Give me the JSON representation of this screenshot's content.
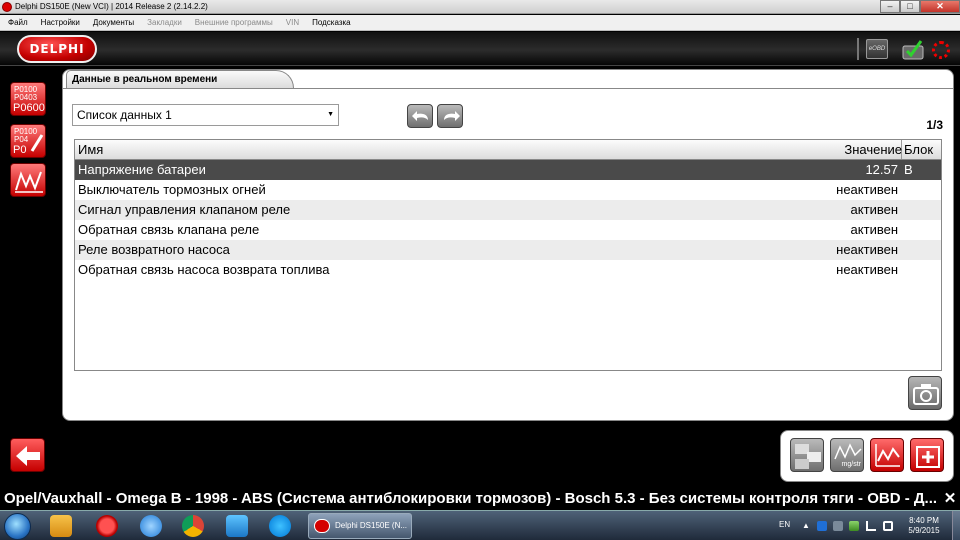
{
  "window": {
    "title": "Delphi DS150E (New VCI) | 2014 Release 2 (2.14.2.2)",
    "minimize": "–",
    "maximize": "□",
    "close": "✕"
  },
  "menu": [
    {
      "label": "Файл",
      "enabled": true
    },
    {
      "label": "Настройки",
      "enabled": true
    },
    {
      "label": "Документы",
      "enabled": true
    },
    {
      "label": "Закладки",
      "enabled": false
    },
    {
      "label": "Внешние программы",
      "enabled": false
    },
    {
      "label": "VIN",
      "enabled": false
    },
    {
      "label": "Подсказка",
      "enabled": true
    }
  ],
  "header": {
    "logo_text": "DELPHI",
    "eobd_label": "eOBD"
  },
  "sidebar": {
    "btn1": {
      "l1": "P0100",
      "l2": "P0403",
      "l3": "P0600"
    },
    "btn2": {
      "l1": "P0100",
      "l2": "P04",
      "l3": "P0"
    }
  },
  "panel": {
    "tab_title": "Данные в реальном времени",
    "dataset_selected": "Список данных 1",
    "page_indicator": "1/3"
  },
  "table": {
    "columns": {
      "name": "Имя",
      "value": "Значение",
      "unit": "Блок"
    },
    "rows": [
      {
        "name": "Напряжение батареи",
        "value": "12.57",
        "unit": "В"
      },
      {
        "name": "Выключатель тормозных огней",
        "value": "неактивен",
        "unit": ""
      },
      {
        "name": "Сигнал управления клапаном реле",
        "value": "активен",
        "unit": ""
      },
      {
        "name": "Обратная связь клапана реле",
        "value": "активен",
        "unit": ""
      },
      {
        "name": "Реле возвратного насоса",
        "value": "неактивен",
        "unit": ""
      },
      {
        "name": "Обратная связь насоса возврата топлива",
        "value": "неактивен",
        "unit": ""
      }
    ]
  },
  "toolbar": {
    "graph_label": "mg/str"
  },
  "status_bar": {
    "text": "Opel/Vauxhall - Omega B - 1998 - ABS (Система антиблокировки тормозов) - Bosch 5.3 - Без системы контроля тяги - OBD - Д...",
    "close": "✕"
  },
  "taskbar": {
    "app_label": "Delphi DS150E (N...",
    "language": "EN",
    "time": "8:40 PM",
    "date": "5/9/2015"
  },
  "colors": {
    "accent_red": "#c50000",
    "selected_row": "#4a4a4a",
    "alt_row": "#ececec"
  }
}
